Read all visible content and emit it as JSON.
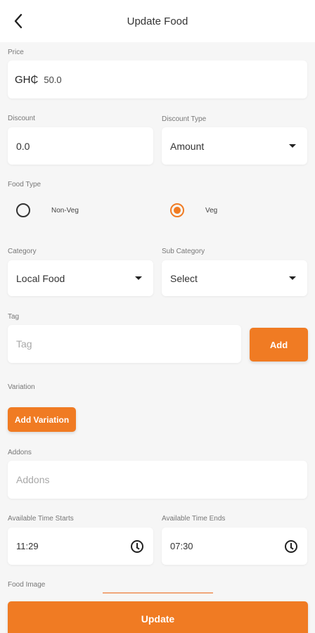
{
  "header": {
    "title": "Update Food",
    "back_icon": "chevron-left-icon"
  },
  "price": {
    "label": "Price",
    "currency": "GH₵",
    "value": "50.0"
  },
  "discount": {
    "label": "Discount",
    "value": "0.0"
  },
  "discount_type": {
    "label": "Discount Type",
    "selected": "Amount"
  },
  "food_type": {
    "label": "Food Type",
    "options": [
      {
        "label": "Non-Veg",
        "selected": false
      },
      {
        "label": "Veg",
        "selected": true
      }
    ]
  },
  "category": {
    "label": "Category",
    "selected": "Local Food"
  },
  "sub_category": {
    "label": "Sub Category",
    "selected": "Select"
  },
  "tag": {
    "label": "Tag",
    "placeholder": "Tag",
    "add_label": "Add"
  },
  "variation": {
    "label": "Variation",
    "button_label": "Add Variation"
  },
  "addons": {
    "label": "Addons",
    "placeholder": "Addons"
  },
  "time_start": {
    "label": "Available Time Starts",
    "value": "11:29"
  },
  "time_end": {
    "label": "Available Time Ends",
    "value": "07:30"
  },
  "food_image": {
    "label": "Food Image"
  },
  "update": {
    "label": "Update"
  },
  "colors": {
    "accent": "#f07b23",
    "background": "#f6f6f6"
  }
}
